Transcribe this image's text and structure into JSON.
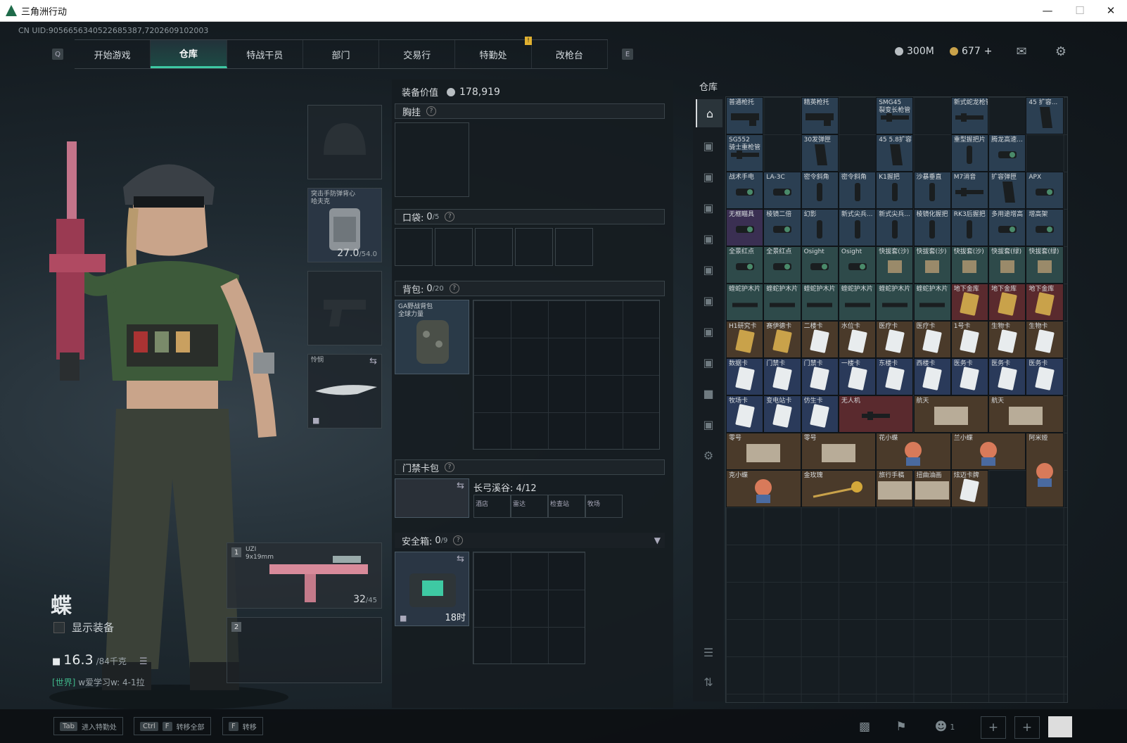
{
  "window": {
    "title": "三角洲行动"
  },
  "uid": "CN UID:9056656340522685387,7202609102003",
  "nav": {
    "left_key": "Q",
    "right_key": "E",
    "tabs": [
      "开始游戏",
      "仓库",
      "特战干员",
      "部门",
      "交易行",
      "特勤处",
      "改枪台"
    ],
    "active": "仓库"
  },
  "currency": {
    "coins": "300M",
    "premium": "677",
    "plus": "+"
  },
  "character": {
    "name": "蝶",
    "show_equipment": "显示装备",
    "weight": "16.3",
    "weight_max": "/84千克",
    "chat_channel": "[世界]",
    "chat_text": "w爱学习w: 4-1拉"
  },
  "equipment": {
    "armor_label": "突击手防弹背心\n哈夫克",
    "armor_dur": "27.0",
    "armor_dur_max": "/54.0",
    "melee_label": "怜悯",
    "primary_slot": "1",
    "primary_label": "UZI\n9x19mm",
    "primary_ammo": "32",
    "primary_ammo_max": "/45",
    "secondary_slot": "2"
  },
  "loadout": {
    "value_label": "装备价值",
    "value": "178,919",
    "chest_rig": "胸挂",
    "pockets": "口袋:",
    "pockets_count": "0",
    "pockets_max": "/5",
    "backpack": "背包:",
    "backpack_count": "0",
    "backpack_max": "/20",
    "backpack_item": "GA野战背包\n全球力量",
    "keycard": "门禁卡包",
    "keycard_map": "长弓溪谷: 4/12",
    "keycard_slots": [
      "酒店",
      "雷达",
      "检查站",
      "牧场"
    ],
    "safebox": "安全箱:",
    "safebox_count": "0",
    "safebox_max": "/9",
    "safebox_timer": "18时"
  },
  "storage": {
    "title": "仓库",
    "items": [
      {
        "name": "普通枪托",
        "r": 0,
        "c": 0,
        "color": "#2b3f52",
        "icon": "stock"
      },
      {
        "name": "精英枪托",
        "r": 0,
        "c": 2,
        "color": "#2b3f52",
        "icon": "stock"
      },
      {
        "name": "SMG45\n裂变长枪管",
        "r": 0,
        "c": 4,
        "color": "#2b3f52",
        "icon": "barrel"
      },
      {
        "name": "新式蛇龙枪管",
        "r": 0,
        "c": 6,
        "color": "#2b3f52",
        "icon": "barrel"
      },
      {
        "name": "45 扩容...",
        "r": 0,
        "c": 8,
        "color": "#2b3f52",
        "icon": "mag"
      },
      {
        "name": "SG552\n骑士重枪管",
        "r": 1,
        "c": 0,
        "color": "#2b3f52",
        "icon": "barrel"
      },
      {
        "name": "30发弹匣",
        "r": 1,
        "c": 2,
        "color": "#2b3f52",
        "icon": "mag"
      },
      {
        "name": "45 5.8扩容",
        "r": 1,
        "c": 4,
        "color": "#2b3f52",
        "icon": "mag"
      },
      {
        "name": "重型握把片",
        "r": 1,
        "c": 6,
        "color": "#2b3f52",
        "icon": "grip"
      },
      {
        "name": "腾龙高速...",
        "r": 1,
        "c": 7,
        "color": "#2b3f52",
        "icon": "sight"
      },
      {
        "name": "战术手电",
        "r": 2,
        "c": 0,
        "color": "#2b3f52",
        "icon": "sight"
      },
      {
        "name": "LA-3C",
        "r": 2,
        "c": 1,
        "color": "#2b3f52",
        "icon": "sight"
      },
      {
        "name": "密令斜角",
        "r": 2,
        "c": 2,
        "color": "#2b3f52",
        "icon": "grip"
      },
      {
        "name": "密令斜角",
        "r": 2,
        "c": 3,
        "color": "#2b3f52",
        "icon": "grip"
      },
      {
        "name": "K1握把",
        "r": 2,
        "c": 4,
        "color": "#2b3f52",
        "icon": "grip"
      },
      {
        "name": "沙暴垂直",
        "r": 2,
        "c": 5,
        "color": "#2b3f52",
        "icon": "grip"
      },
      {
        "name": "M7消音",
        "r": 2,
        "c": 6,
        "color": "#2b3f52",
        "icon": "barrel"
      },
      {
        "name": "扩容弹匣",
        "r": 2,
        "c": 7,
        "color": "#2b3f52",
        "icon": "mag"
      },
      {
        "name": "APX",
        "r": 2,
        "c": 8,
        "color": "#2b3f52",
        "icon": "sight"
      },
      {
        "name": "无框瞄具",
        "r": 3,
        "c": 0,
        "color": "#3a2f52",
        "icon": "sight"
      },
      {
        "name": "棱镜二倍",
        "r": 3,
        "c": 1,
        "color": "#2b3f52",
        "icon": "sight"
      },
      {
        "name": "幻影",
        "r": 3,
        "c": 2,
        "color": "#2b3f52",
        "icon": "grip"
      },
      {
        "name": "新式尖兵...",
        "r": 3,
        "c": 3,
        "color": "#2b3f52",
        "icon": "grip"
      },
      {
        "name": "新式尖兵...",
        "r": 3,
        "c": 4,
        "color": "#2b3f52",
        "icon": "grip"
      },
      {
        "name": "棱镜化握把",
        "r": 3,
        "c": 5,
        "color": "#2b3f52",
        "icon": "grip"
      },
      {
        "name": "RK3后握把",
        "r": 3,
        "c": 6,
        "color": "#2b3f52",
        "icon": "grip"
      },
      {
        "name": "多用途增高",
        "r": 3,
        "c": 7,
        "color": "#2b3f52",
        "icon": "sight"
      },
      {
        "name": "增高架",
        "r": 3,
        "c": 8,
        "color": "#2b3f52",
        "icon": "sight"
      },
      {
        "name": "全景红点",
        "r": 4,
        "c": 0,
        "color": "#2e4a4a",
        "icon": "sight"
      },
      {
        "name": "全景红点",
        "r": 4,
        "c": 1,
        "color": "#2e4a4a",
        "icon": "sight"
      },
      {
        "name": "Osight",
        "r": 4,
        "c": 2,
        "color": "#2e4a4a",
        "icon": "sight"
      },
      {
        "name": "Osight",
        "r": 4,
        "c": 3,
        "color": "#2e4a4a",
        "icon": "sight"
      },
      {
        "name": "快拔套(沙)",
        "r": 4,
        "c": 4,
        "color": "#2e4a4a",
        "icon": "pouch"
      },
      {
        "name": "快拔套(沙)",
        "r": 4,
        "c": 5,
        "color": "#2e4a4a",
        "icon": "pouch"
      },
      {
        "name": "快拔套(沙)",
        "r": 4,
        "c": 6,
        "color": "#2e4a4a",
        "icon": "pouch"
      },
      {
        "name": "快拔套(绿)",
        "r": 4,
        "c": 7,
        "color": "#2e4a4a",
        "icon": "pouch"
      },
      {
        "name": "快拔套(绿)",
        "r": 4,
        "c": 8,
        "color": "#2e4a4a",
        "icon": "pouch"
      },
      {
        "name": "蝰蛇护木片",
        "r": 5,
        "c": 0,
        "color": "#2e4a4a",
        "icon": "rail"
      },
      {
        "name": "蝰蛇护木片",
        "r": 5,
        "c": 1,
        "color": "#2e4a4a",
        "icon": "rail"
      },
      {
        "name": "蝰蛇护木片",
        "r": 5,
        "c": 2,
        "color": "#2e4a4a",
        "icon": "rail"
      },
      {
        "name": "蝰蛇护木片",
        "r": 5,
        "c": 3,
        "color": "#2e4a4a",
        "icon": "rail"
      },
      {
        "name": "蝰蛇护木片",
        "r": 5,
        "c": 4,
        "color": "#2e4a4a",
        "icon": "rail"
      },
      {
        "name": "蝰蛇护木片",
        "r": 5,
        "c": 5,
        "color": "#2e4a4a",
        "icon": "rail"
      },
      {
        "name": "地下金库",
        "r": 5,
        "c": 6,
        "color": "#5a2a2e",
        "icon": "card-gold"
      },
      {
        "name": "地下金库",
        "r": 5,
        "c": 7,
        "color": "#5a2a2e",
        "icon": "card-gold"
      },
      {
        "name": "地下金库",
        "r": 5,
        "c": 8,
        "color": "#5a2a2e",
        "icon": "card-gold"
      },
      {
        "name": "H1研究卡",
        "r": 6,
        "c": 0,
        "color": "#4a3a2a",
        "icon": "card-gold"
      },
      {
        "name": "赛伊德卡",
        "r": 6,
        "c": 1,
        "color": "#4a3a2a",
        "icon": "card-gold"
      },
      {
        "name": "二楼卡",
        "r": 6,
        "c": 2,
        "color": "#4a3a2a",
        "icon": "card"
      },
      {
        "name": "水位卡",
        "r": 6,
        "c": 3,
        "color": "#4a3a2a",
        "icon": "card"
      },
      {
        "name": "医疗卡",
        "r": 6,
        "c": 4,
        "color": "#4a3a2a",
        "icon": "card"
      },
      {
        "name": "医疗卡",
        "r": 6,
        "c": 5,
        "color": "#4a3a2a",
        "icon": "card"
      },
      {
        "name": "1号卡",
        "r": 6,
        "c": 6,
        "color": "#4a3a2a",
        "icon": "card"
      },
      {
        "name": "生物卡",
        "r": 6,
        "c": 7,
        "color": "#4a3a2a",
        "icon": "card"
      },
      {
        "name": "生物卡",
        "r": 6,
        "c": 8,
        "color": "#4a3a2a",
        "icon": "card"
      },
      {
        "name": "数据卡",
        "r": 7,
        "c": 0,
        "color": "#2a3a5a",
        "icon": "card"
      },
      {
        "name": "门禁卡",
        "r": 7,
        "c": 1,
        "color": "#2a3a5a",
        "icon": "card"
      },
      {
        "name": "门禁卡",
        "r": 7,
        "c": 2,
        "color": "#2a3a5a",
        "icon": "card"
      },
      {
        "name": "一楼卡",
        "r": 7,
        "c": 3,
        "color": "#2a3a5a",
        "icon": "card"
      },
      {
        "name": "东楼卡",
        "r": 7,
        "c": 4,
        "color": "#2a3a5a",
        "icon": "card"
      },
      {
        "name": "西楼卡",
        "r": 7,
        "c": 5,
        "color": "#2a3a5a",
        "icon": "card"
      },
      {
        "name": "医务卡",
        "r": 7,
        "c": 6,
        "color": "#2a3a5a",
        "icon": "card"
      },
      {
        "name": "医务卡",
        "r": 7,
        "c": 7,
        "color": "#2a3a5a",
        "icon": "card"
      },
      {
        "name": "医务卡",
        "r": 7,
        "c": 8,
        "color": "#2a3a5a",
        "icon": "card"
      },
      {
        "name": "牧场卡",
        "r": 8,
        "c": 0,
        "color": "#2a3a5a",
        "icon": "card"
      },
      {
        "name": "变电站卡",
        "r": 8,
        "c": 1,
        "color": "#2a3a5a",
        "icon": "card"
      },
      {
        "name": "仿生卡",
        "r": 8,
        "c": 2,
        "color": "#2a3a5a",
        "icon": "card"
      },
      {
        "name": "无人机",
        "r": 8,
        "c": 3,
        "color": "#5a2a2e",
        "icon": "barrel",
        "w": 2
      },
      {
        "name": "航天",
        "r": 8,
        "c": 5,
        "color": "#4a3a2a",
        "icon": "map",
        "w": 2
      },
      {
        "name": "航天",
        "r": 8,
        "c": 7,
        "color": "#4a3a2a",
        "icon": "map",
        "w": 2
      },
      {
        "name": "零号",
        "r": 9,
        "c": 0,
        "color": "#4a3a2a",
        "icon": "map",
        "w": 2
      },
      {
        "name": "零号",
        "r": 9,
        "c": 2,
        "color": "#4a3a2a",
        "icon": "map",
        "w": 2
      },
      {
        "name": "花小蝶",
        "r": 9,
        "c": 4,
        "color": "#4a3a2a",
        "icon": "figure",
        "w": 2
      },
      {
        "name": "兰小蝶",
        "r": 9,
        "c": 6,
        "color": "#4a3a2a",
        "icon": "figure",
        "w": 2
      },
      {
        "name": "阿米娅",
        "r": 9,
        "c": 8,
        "color": "#4a3a2a",
        "icon": "figure",
        "h": 2
      },
      {
        "name": "克小蝶",
        "r": 10,
        "c": 0,
        "color": "#4a3a2a",
        "icon": "figure",
        "w": 2
      },
      {
        "name": "金玫瑰",
        "r": 10,
        "c": 2,
        "color": "#4a3a2a",
        "icon": "rose",
        "w": 2
      },
      {
        "name": "旅行手稿",
        "r": 10,
        "c": 4,
        "color": "#4a3a2a",
        "icon": "map"
      },
      {
        "name": "扭曲油画",
        "r": 10,
        "c": 5,
        "color": "#4a3a2a",
        "icon": "map"
      },
      {
        "name": "炫迈卡牌",
        "r": 10,
        "c": 6,
        "color": "#4a3a2a",
        "icon": "card"
      }
    ]
  },
  "bottom": {
    "keys": [
      {
        "key": "Tab",
        "label": "进入特勤处"
      },
      {
        "key": "Ctrl",
        "key2": "F",
        "label": "转移全部"
      },
      {
        "key": "F",
        "label": "转移"
      }
    ],
    "squad_count": "1"
  },
  "colors": {
    "accent": "#3ec9a3"
  }
}
